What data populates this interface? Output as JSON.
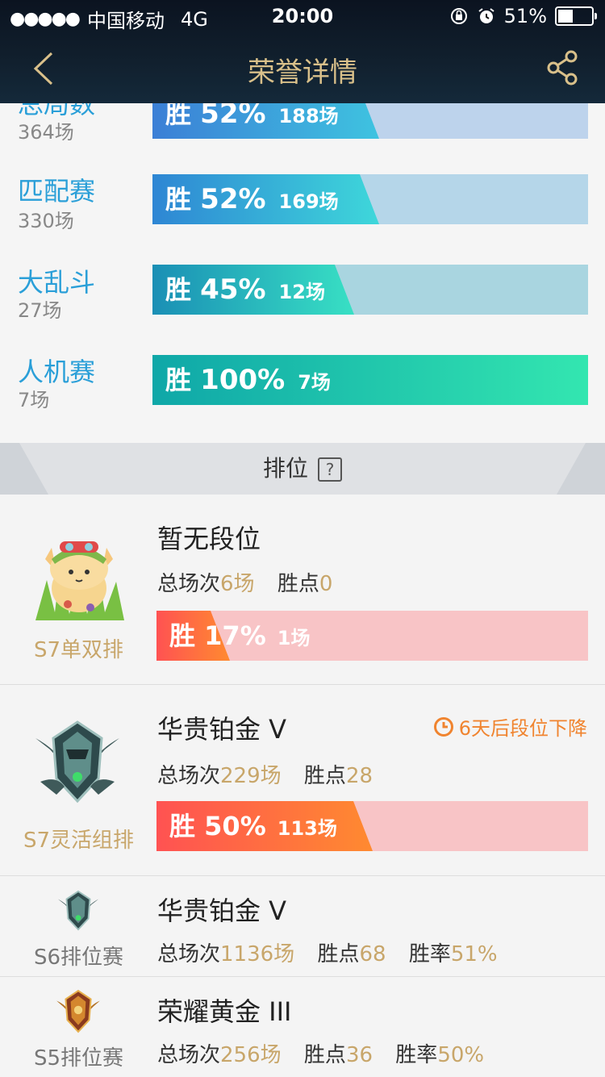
{
  "status_bar": {
    "carrier": "中国移动",
    "network": "4G",
    "time": "20:00",
    "battery": "51%",
    "battery_level": 0.51
  },
  "nav": {
    "title": "荣誉详情"
  },
  "modes": [
    {
      "name": "总局数",
      "count": "364场",
      "win_label": "胜",
      "pct": "52%",
      "games": "188场",
      "win_rate": 0.52,
      "colors": [
        "#3b7fd6",
        "#3ec3e0"
      ],
      "track": "#bdd3ec"
    },
    {
      "name": "匹配赛",
      "count": "330场",
      "win_label": "胜",
      "pct": "52%",
      "games": "169场",
      "win_rate": 0.52,
      "colors": [
        "#2e86d4",
        "#3ed7da"
      ],
      "track": "#b5d6e9"
    },
    {
      "name": "大乱斗",
      "count": "27场",
      "win_label": "胜",
      "pct": "45%",
      "games": "12场",
      "win_rate": 0.45,
      "colors": [
        "#1a8fb5",
        "#38e0c4"
      ],
      "track": "#a9d5e0"
    },
    {
      "name": "人机赛",
      "count": "7场",
      "win_label": "胜",
      "pct": "100%",
      "games": "7场",
      "win_rate": 1.0,
      "colors": [
        "#0fa7a8",
        "#33e6b0"
      ],
      "track": "#a9dddc"
    }
  ],
  "section": {
    "title": "排位",
    "help": "?"
  },
  "s7_solo": {
    "season": "S7单双排",
    "tier": "暂无段位",
    "total_label": "总场次",
    "total": "6场",
    "points_label": "胜点",
    "points": "0",
    "win_label": "胜",
    "pct": "17%",
    "games": "1场",
    "win_rate": 0.17
  },
  "s7_flex": {
    "season": "S7灵活组排",
    "tier": "华贵铂金 V",
    "decay": "6天后段位下降",
    "total_label": "总场次",
    "total": "229场",
    "points_label": "胜点",
    "points": "28",
    "win_label": "胜",
    "pct": "50%",
    "games": "113场",
    "win_rate": 0.5
  },
  "s6": {
    "season": "S6排位赛",
    "tier": "华贵铂金 V",
    "total_label": "总场次",
    "total": "1136场",
    "points_label": "胜点",
    "points": "68",
    "rate_label": "胜率",
    "rate": "51%"
  },
  "s5": {
    "season": "S5排位赛",
    "tier": "荣耀黄金 III",
    "total_label": "总场次",
    "total": "256场",
    "points_label": "胜点",
    "points": "36",
    "rate_label": "胜率",
    "rate": "50%"
  }
}
